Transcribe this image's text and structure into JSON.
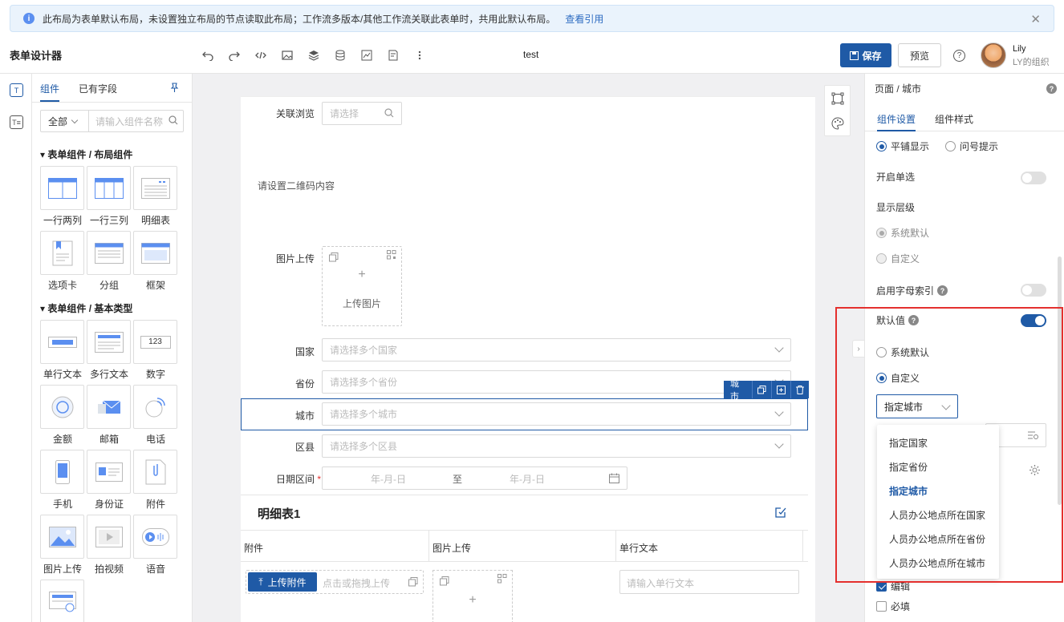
{
  "notice": {
    "text": "此布局为表单默认布局，未设置独立布局的节点读取此布局；工作流多版本/其他工作流关联此表单时，共用此默认布局。",
    "link": "查看引用",
    "close": "✕"
  },
  "toolbar": {
    "title": "表单设计器",
    "form_name": "test",
    "save": "保存",
    "preview": "预览",
    "help": "?",
    "user_name": "Lily",
    "user_org": "LY的组织"
  },
  "left_panel": {
    "tab_components": "组件",
    "tab_fields": "已有字段",
    "filter_value": "全部",
    "search_placeholder": "请输入组件名称",
    "group_layout": "表单组件 / 布局组件",
    "group_basic": "表单组件 / 基本类型",
    "layout_items": [
      "一行两列",
      "一行三列",
      "明细表",
      "选项卡",
      "分组",
      "框架"
    ],
    "basic_items": [
      "单行文本",
      "多行文本",
      "数字",
      "金额",
      "邮箱",
      "电话",
      "手机",
      "身份证",
      "附件",
      "图片上传",
      "拍视频",
      "语音"
    ],
    "number_icon_text": "123"
  },
  "rail": {
    "icon1": "T",
    "icon2": "T≡"
  },
  "form": {
    "linked_browse_label": "关联浏览",
    "linked_browse_placeholder": "请选择",
    "qr_text": "请设置二维码内容",
    "image_upload_label": "图片上传",
    "image_upload_text": "上传图片",
    "country_label": "国家",
    "country_placeholder": "请选择多个国家",
    "province_label": "省份",
    "province_placeholder": "请选择多个省份",
    "city_label": "城市",
    "city_placeholder": "请选择多个城市",
    "district_label": "区县",
    "district_placeholder": "请选择多个区县",
    "date_range_label": "日期区间",
    "required_mark": "*",
    "date_start": "年-月-日",
    "date_to": "至",
    "date_end": "年-月-日",
    "selected_tag": "城市",
    "detail_title": "明细表1",
    "detail_cols": [
      "附件",
      "图片上传",
      "单行文本"
    ],
    "upload_btn": "上传附件",
    "upload_hint": "点击或拖拽上传",
    "text_placeholder": "请输入单行文本"
  },
  "right_panel": {
    "breadcrumb": "页面 / 城市",
    "tab_settings": "组件设置",
    "tab_style": "组件样式",
    "display_tile": "平铺显示",
    "display_question": "问号提示",
    "single_select": "开启单选",
    "display_level": "显示层级",
    "level_system": "系统默认",
    "level_custom": "自定义",
    "letter_index": "启用字母索引",
    "default_value": "默认值",
    "default_system": "系统默认",
    "default_custom": "自定义",
    "select_value": "指定城市",
    "edit": "编辑",
    "required": "必填"
  },
  "dropdown": {
    "options": [
      "指定国家",
      "指定省份",
      "指定城市",
      "人员办公地点所在国家",
      "人员办公地点所在省份",
      "人员办公地点所在城市"
    ],
    "selected_index": 2
  },
  "colors": {
    "primary": "#1f5aa6",
    "highlight_box": "#e4302e"
  }
}
